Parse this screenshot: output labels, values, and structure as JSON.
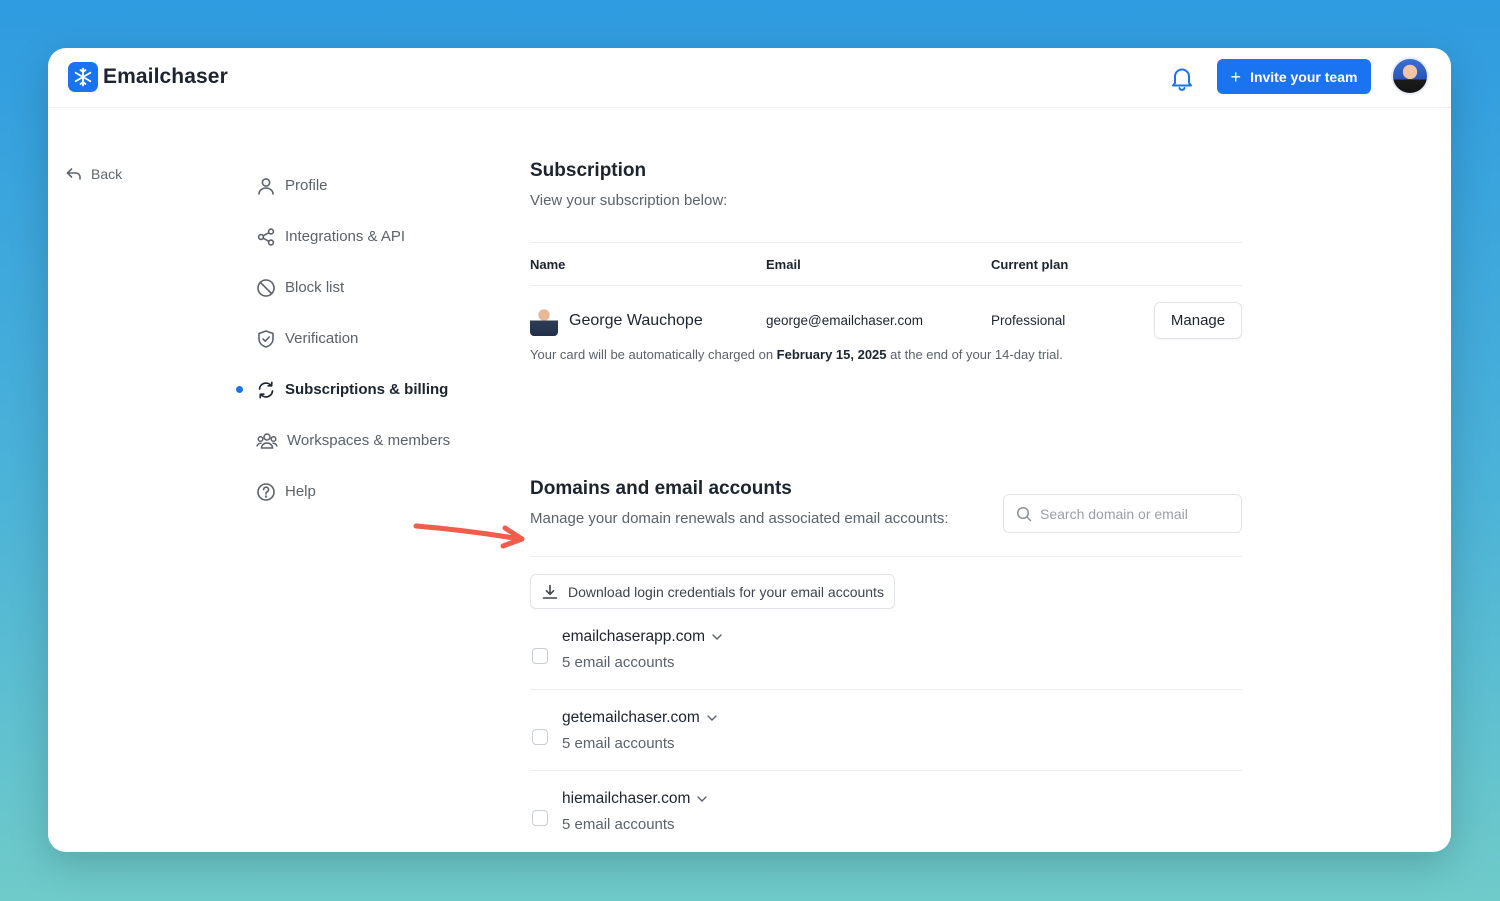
{
  "app": {
    "name": "Emailchaser",
    "accent": "#1a73f0"
  },
  "header": {
    "invite_label": "Invite your team",
    "bell_icon": "bell-icon",
    "avatar": "user-avatar"
  },
  "back_label": "Back",
  "nav": {
    "items": [
      {
        "label": "Profile",
        "icon": "person-icon"
      },
      {
        "label": "Integrations & API",
        "icon": "share-icon"
      },
      {
        "label": "Block list",
        "icon": "block-icon"
      },
      {
        "label": "Verification",
        "icon": "shield-check-icon"
      },
      {
        "label": "Subscriptions & billing",
        "icon": "refresh-icon",
        "active": true
      },
      {
        "label": "Workspaces & members",
        "icon": "users-icon"
      },
      {
        "label": "Help",
        "icon": "help-icon"
      }
    ]
  },
  "subscription": {
    "title": "Subscription",
    "subtitle": "View your subscription below:",
    "columns": [
      "Name",
      "Email",
      "Current plan"
    ],
    "row": {
      "name": "George Wauchope",
      "email": "george@emailchaser.com",
      "plan": "Professional"
    },
    "manage_label": "Manage",
    "note_prefix": "Your card will be automatically charged on ",
    "note_date": "February 15, 2025",
    "note_suffix": " at the end of your 14-day trial."
  },
  "domains": {
    "title": "Domains and email accounts",
    "subtitle": "Manage your domain renewals and associated email accounts:",
    "search_placeholder": "Search domain or email",
    "download_label": "Download login credentials for your email accounts",
    "items": [
      {
        "domain": "emailchaserapp.com",
        "count": "5 email accounts"
      },
      {
        "domain": "getemailchaser.com",
        "count": "5 email accounts"
      },
      {
        "domain": "hiemailchaser.com",
        "count": "5 email accounts"
      }
    ]
  },
  "annotation": {
    "arrow_color": "#f25c4a"
  }
}
